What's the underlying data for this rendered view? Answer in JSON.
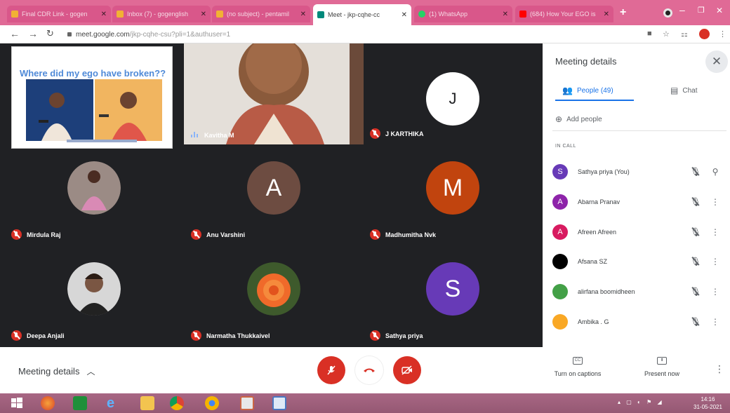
{
  "browser": {
    "tabs": [
      {
        "title": "Final CDR Link - gogen",
        "favicon_color": "#f2b134"
      },
      {
        "title": "Inbox (7) - gogenglish",
        "favicon_color": "#f2b134"
      },
      {
        "title": "(no subject) - pentamil",
        "favicon_color": "#f2b134"
      },
      {
        "title": "Meet - jkp-cqhe-cc",
        "favicon_color": "#00897b"
      },
      {
        "title": "(1) WhatsApp",
        "favicon_color": "#25d366"
      },
      {
        "title": "(684) How Your EGO is",
        "favicon_color": "#ff0000"
      }
    ],
    "new_tab": "+",
    "window_controls": [
      "–",
      "❐",
      "✕"
    ],
    "url_host": "meet.google.com",
    "url_path": "/jkp-cqhe-csu?pli=1&authuser=1"
  },
  "stage": {
    "slide_title": "Where did my ego have broken??",
    "participants": [
      {
        "name": "Kavitha M",
        "kind": "video"
      },
      {
        "name": "J KARTHIKA",
        "initial": "J",
        "color": "#ffffff",
        "text_color": "#202124"
      },
      {
        "name": "Mirdula Raj",
        "kind": "photo"
      },
      {
        "name": "Anu Varshini",
        "initial": "A",
        "color": "#6d4c41"
      },
      {
        "name": "Madhumitha Nvk",
        "initial": "M",
        "color": "#c1440e"
      },
      {
        "name": "Deepa Anjali",
        "kind": "photo"
      },
      {
        "name": "Narmatha Thukkaivel",
        "kind": "photo"
      },
      {
        "name": "Sathya priya",
        "initial": "S",
        "color": "#673ab7"
      }
    ]
  },
  "panel": {
    "title": "Meeting details",
    "tab_people": "People (49)",
    "tab_chat": "Chat",
    "add_people": "Add people",
    "section_label": "IN CALL",
    "people": [
      {
        "name": "Sathya priya (You)",
        "initial": "S",
        "color": "#673ab7"
      },
      {
        "name": "Abarna Pranav",
        "initial": "A",
        "color": "#8e24aa"
      },
      {
        "name": "Afreen Afreen",
        "initial": "A",
        "color": "#d81b60"
      },
      {
        "name": "Afsana SZ",
        "initial": "",
        "color": "#000000"
      },
      {
        "name": "alirfana boomidheen",
        "initial": "",
        "color": "#43a047"
      },
      {
        "name": "Ambika . G",
        "initial": "",
        "color": "#f9a825"
      }
    ]
  },
  "bottom": {
    "meeting_details": "Meeting details",
    "captions_label": "Turn on captions",
    "captions_icon_text": "CC",
    "present_label": "Present now"
  },
  "taskbar": {
    "time": "14:16",
    "date": "31-05-2021"
  }
}
